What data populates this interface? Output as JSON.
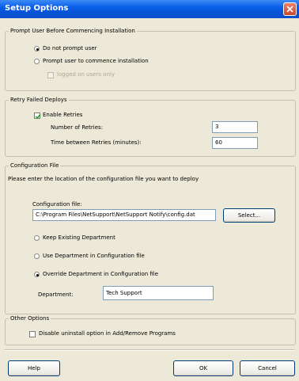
{
  "window": {
    "title": "Setup Options",
    "close_icon": "close-icon",
    "accent_color": "#0a5ee8"
  },
  "prompt_group": {
    "legend": "Prompt User Before Commencing Installation",
    "options": [
      {
        "label": "Do not prompt user",
        "selected": true
      },
      {
        "label": "Prompt user to commence installation",
        "selected": false
      }
    ],
    "logged_on_only": {
      "label": "logged on users only",
      "checked": false,
      "enabled": false
    }
  },
  "retry_group": {
    "legend": "Retry Failed Deploys",
    "enable": {
      "label": "Enable Retries",
      "checked": true
    },
    "retries_label": "Number of Retries:",
    "retries_value": "3",
    "time_label": "Time between Retries (minutes):",
    "time_value": "60"
  },
  "config_group": {
    "legend": "Configuration File",
    "instruction": "Please enter the location of the configuration file you want to deploy",
    "file_label": "Configuration file:",
    "file_value": "C:\\Program Files\\NetSupport\\NetSupport Notify\\config.dat",
    "select_button": "Select...",
    "options": [
      {
        "label": "Keep Existing Department",
        "selected": false
      },
      {
        "label": "Use Department in Configuration file",
        "selected": false
      },
      {
        "label": "Override Department in Configuration file",
        "selected": true
      }
    ],
    "department_label": "Department:",
    "department_value": "Tech Support"
  },
  "other_group": {
    "legend": "Other Options",
    "disable_uninstall": {
      "label": "Disable uninstall option in Add/Remove Programs",
      "checked": false
    }
  },
  "footer": {
    "help": "Help",
    "ok": "OK",
    "cancel": "Cancel"
  }
}
